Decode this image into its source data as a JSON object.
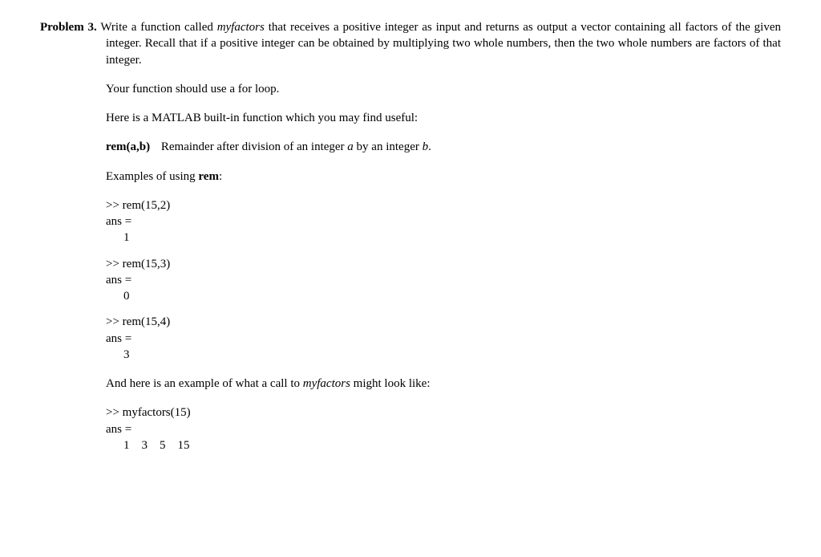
{
  "problem": {
    "label": "Problem 3.",
    "func_name": "myfactors",
    "intro_before": " Write a function called ",
    "intro_after": " that receives a positive integer as input and returns as output a vector containing all factors of the given integer. Recall that if a positive integer can be obtained by multiplying two whole numbers, then the two whole numbers are factors of that integer.",
    "forloop": "Your function should use a for loop.",
    "builtin_intro": "Here is a MATLAB built-in function which you may find useful:",
    "rem_sig": "rem(a,b)",
    "rem_desc_1": "Remainder after division of an integer ",
    "rem_a": "a",
    "rem_desc_2": " by an integer ",
    "rem_b": "b",
    "rem_desc_3": ".",
    "examples_label_1": "Examples of using ",
    "examples_rem": "rem",
    "examples_label_2": ":",
    "ex1_call": ">> rem(15,2)",
    "ex1_ans": "ans =",
    "ex1_val": "1",
    "ex2_call": ">> rem(15,3)",
    "ex2_ans": "ans =",
    "ex2_val": "0",
    "ex3_call": ">> rem(15,4)",
    "ex3_ans": "ans =",
    "ex3_val": "3",
    "example_call_intro_1": "And here is an example of what a call to ",
    "example_call_intro_func": "myfactors",
    "example_call_intro_2": " might look like:",
    "ex4_call": ">> myfactors(15)",
    "ex4_ans": "ans =",
    "ex4_val": "1    3    5    15"
  }
}
